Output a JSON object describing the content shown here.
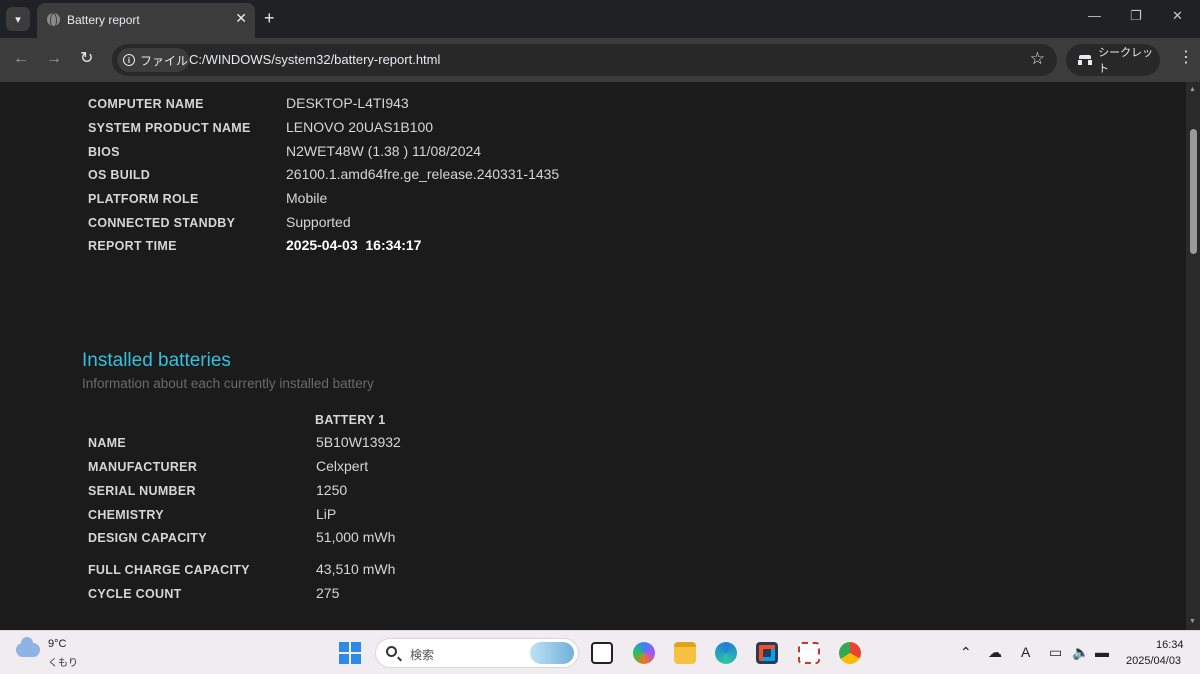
{
  "browser": {
    "tab_title": "Battery report",
    "tab_close": "✕",
    "new_tab": "+",
    "chip_label": "ファイル",
    "url": "C:/WINDOWS/system32/battery-report.html",
    "incognito_label": "シークレット",
    "icons": [
      "tab-search-icon",
      "globe-icon",
      "back-icon",
      "forward-icon",
      "reload-icon",
      "info-icon",
      "star-icon",
      "incognito-icon",
      "menu-icon"
    ]
  },
  "system_info": [
    {
      "label": "COMPUTER NAME",
      "value": "DESKTOP-L4TI943"
    },
    {
      "label": "SYSTEM PRODUCT NAME",
      "value": "LENOVO 20UAS1B100"
    },
    {
      "label": "BIOS",
      "value": "N2WET48W (1.38 ) 11/08/2024"
    },
    {
      "label": "OS BUILD",
      "value": "26100.1.amd64fre.ge_release.240331-1435"
    },
    {
      "label": "PLATFORM ROLE",
      "value": "Mobile"
    },
    {
      "label": "CONNECTED STANDBY",
      "value": "Supported"
    },
    {
      "label": "REPORT TIME",
      "value": "2025-04-03  16:34:17"
    }
  ],
  "installed_batteries": {
    "title": "Installed batteries",
    "subtitle": "Information about each currently installed battery",
    "column_header": "BATTERY 1",
    "rows": [
      {
        "label": "NAME",
        "value": "5B10W13932"
      },
      {
        "label": "MANUFACTURER",
        "value": "Celxpert"
      },
      {
        "label": "SERIAL NUMBER",
        "value": "1250"
      },
      {
        "label": "CHEMISTRY",
        "value": "LiP"
      },
      {
        "label": "DESIGN CAPACITY",
        "value": "51,000 mWh"
      },
      {
        "label": "FULL CHARGE CAPACITY",
        "value": "43,510 mWh"
      },
      {
        "label": "CYCLE COUNT",
        "value": "275"
      }
    ]
  },
  "taskbar": {
    "temperature": "9°C",
    "condition": "くもり",
    "search_placeholder": "検索",
    "time": "16:34",
    "date": "2025/04/03",
    "ime_indicator": "A"
  },
  "colors": {
    "accent_title": "#35c0dd",
    "page_background": "#1b1b1b",
    "chrome_toolbar": "#3c3c3c"
  }
}
